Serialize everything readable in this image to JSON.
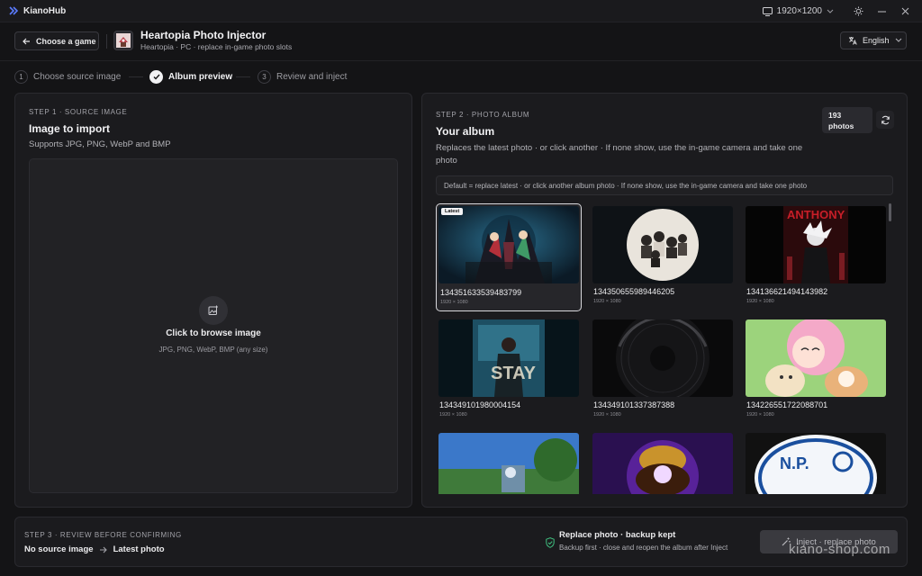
{
  "titlebar": {
    "app_name": "KianoHub",
    "resolution": "1920×1200"
  },
  "header": {
    "back_label": "Choose a game",
    "game_title": "Heartopia Photo Injector",
    "game_subtitle": "Heartopia · PC · replace in-game photo slots",
    "language": "English"
  },
  "steps": [
    {
      "num": "1",
      "label": "Choose source image",
      "state": "todo"
    },
    {
      "num": "",
      "label": "Album preview",
      "state": "active"
    },
    {
      "num": "3",
      "label": "Review and inject",
      "state": "todo"
    }
  ],
  "source": {
    "eyebrow": "STEP 1 · SOURCE IMAGE",
    "title": "Image to import",
    "subtitle": "Supports JPG, PNG, WebP and BMP",
    "drop_title": "Click to browse image",
    "drop_sub": "JPG, PNG, WebP, BMP (any size)"
  },
  "album": {
    "eyebrow": "STEP 2 · PHOTO ALBUM",
    "title": "Your album",
    "subtitle": "Replaces the latest photo · or click another · If none show, use the in-game camera and take one photo",
    "count_value": "193",
    "count_unit": "photos",
    "note": "Default = replace latest · or click another album photo · If none show, use the in-game camera and take one photo",
    "latest_badge": "Latest",
    "photos": [
      {
        "name": "134351633539483799",
        "dims": "1920 × 1080"
      },
      {
        "name": "134350655989446205",
        "dims": "1920 × 1080"
      },
      {
        "name": "134136621494143982",
        "dims": "1920 × 1080"
      },
      {
        "name": "134349101980004154",
        "dims": "1920 × 1080"
      },
      {
        "name": "134349101337387388",
        "dims": "1920 × 1080"
      },
      {
        "name": "134226551722088701",
        "dims": "1920 × 1080"
      },
      {
        "name": "",
        "dims": ""
      },
      {
        "name": "",
        "dims": ""
      },
      {
        "name": "",
        "dims": ""
      }
    ]
  },
  "review": {
    "eyebrow": "STEP 3 · REVIEW BEFORE CONFIRMING",
    "from": "No source image",
    "to": "Latest photo",
    "replace_title": "Replace photo · backup kept",
    "replace_sub": "Backup first · close and reopen the album after Inject",
    "inject_label": "Inject · replace photo"
  },
  "watermark": "kiano-shop.com",
  "colors": {
    "background": "#141416",
    "panel": "#1b1b1e",
    "accent_success": "#3fbf7f",
    "disabled_button": "#3a3a3f"
  }
}
